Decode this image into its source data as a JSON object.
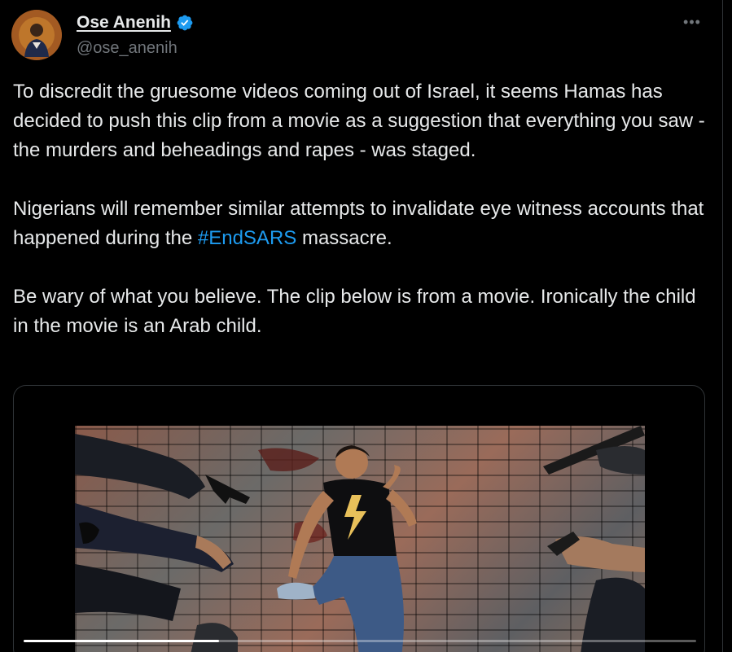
{
  "author": {
    "display_name": "Ose Anenih",
    "handle": "@ose_anenih",
    "verified": true,
    "verified_color": "#1d9bf0"
  },
  "more_label": "•••",
  "tweet": {
    "paragraph1": "To discredit the gruesome videos coming out of Israel, it seems Hamas has decided to push this clip from a movie as a suggestion that everything you saw - the murders and beheadings and rapes - was staged.",
    "paragraph2_before": "Nigerians will remember similar attempts to invalidate eye witness accounts that happened during the ",
    "hashtag": "#EndSARS",
    "paragraph2_after": " massacre.",
    "paragraph3": "Be wary of what you believe. The clip below is from a movie. Ironically the child in the movie is an Arab child."
  },
  "media": {
    "type": "video",
    "progress_fraction": 0.29
  },
  "colors": {
    "background": "#000000",
    "text": "#e7e9ea",
    "secondary_text": "#71767b",
    "link": "#1d9bf0",
    "border": "#2f3336"
  },
  "icons": [
    "verified-badge-icon",
    "more-icon"
  ]
}
